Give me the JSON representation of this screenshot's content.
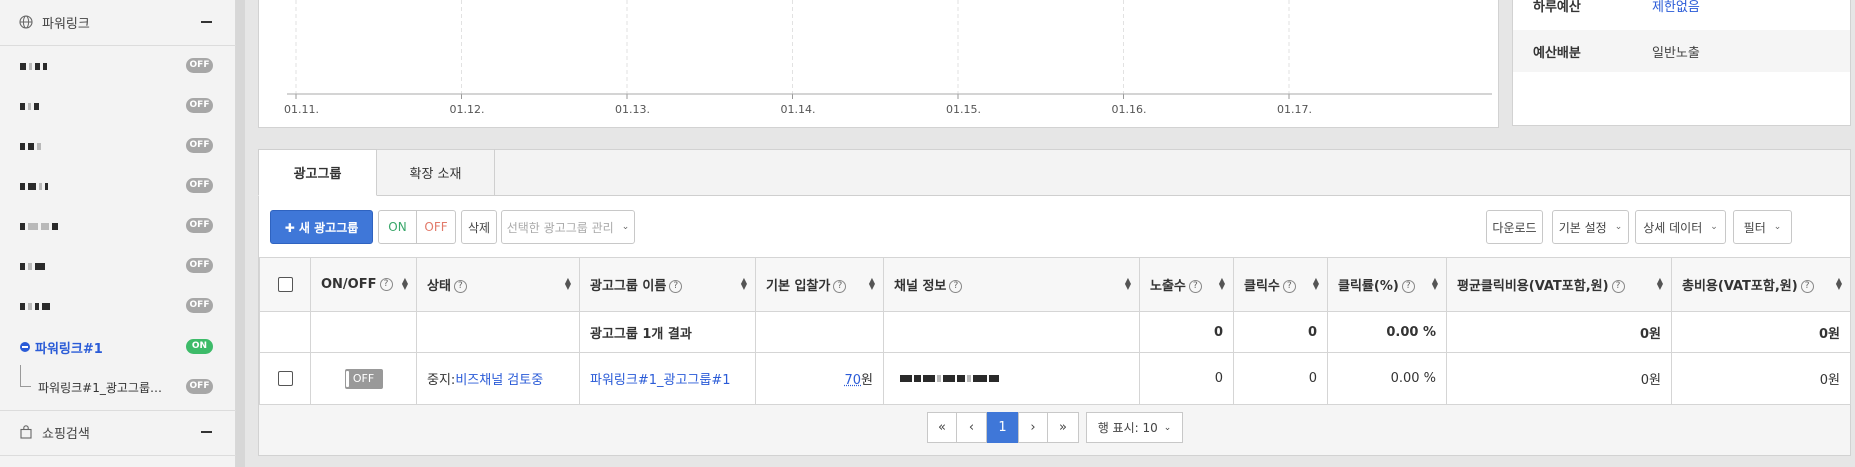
{
  "sidebar": {
    "section1": {
      "title": "파워링크",
      "icon": "globe-icon"
    },
    "items": [
      {
        "status": "OFF"
      },
      {
        "status": "OFF"
      },
      {
        "status": "OFF"
      },
      {
        "status": "OFF"
      },
      {
        "status": "OFF"
      },
      {
        "status": "OFF"
      },
      {
        "status": "OFF"
      }
    ],
    "active_item": {
      "label": "파워링크#1",
      "status": "ON"
    },
    "sub_item": {
      "label": "파워링크#1_광고그룹…",
      "status": "OFF"
    },
    "section2": {
      "title": "쇼핑검색",
      "icon": "shopping-bag-icon"
    }
  },
  "chart_data": {
    "type": "line",
    "categories": [
      "01.11.",
      "01.12.",
      "01.13.",
      "01.14.",
      "01.15.",
      "01.16.",
      "01.17."
    ],
    "series": [],
    "grid": true
  },
  "info": {
    "rows": [
      {
        "label": "하루예산",
        "value": "제한없음",
        "is_link": true
      },
      {
        "label": "예산배분",
        "value": "일반노출",
        "is_link": false
      }
    ]
  },
  "tabs": [
    {
      "label": "광고그룹",
      "active": true
    },
    {
      "label": "확장 소재",
      "active": false
    }
  ],
  "toolbar": {
    "new_group": "✚ 새 광고그룹",
    "on": "ON",
    "off": "OFF",
    "delete": "삭제",
    "manage_selected": "선택한 광고그룹 관리",
    "download": "다운로드",
    "basic_settings": "기본 설정",
    "detail_data": "상세 데이터",
    "filter": "필터"
  },
  "table": {
    "headers": {
      "onoff": "ON/OFF",
      "status": "상태",
      "name": "광고그룹 이름",
      "bid": "기본 입찰가",
      "channel": "채널 정보",
      "impressions": "노출수",
      "clicks": "클릭수",
      "ctr": "클릭률(%)",
      "cpc": "평균클릭비용(VAT포함,원)",
      "cost": "총비용(VAT포함,원)"
    },
    "total": {
      "label": "광고그룹 1개 결과",
      "impressions": "0",
      "clicks": "0",
      "ctr": "0.00 %",
      "cpc": "0원",
      "cost": "0원"
    },
    "rows": [
      {
        "toggle": "OFF",
        "status_prefix": "중지:",
        "status_link": "비즈채널 검토중",
        "name": "파워링크#1_광고그룹#1",
        "bid_value": "70",
        "bid_unit": "원",
        "impressions": "0",
        "clicks": "0",
        "ctr": "0.00 %",
        "cpc": "0원",
        "cost": "0원"
      }
    ]
  },
  "pagination": {
    "first": "«",
    "prev": "‹",
    "current": "1",
    "next": "›",
    "last": "»",
    "rows_label": "행 표시: 10"
  }
}
